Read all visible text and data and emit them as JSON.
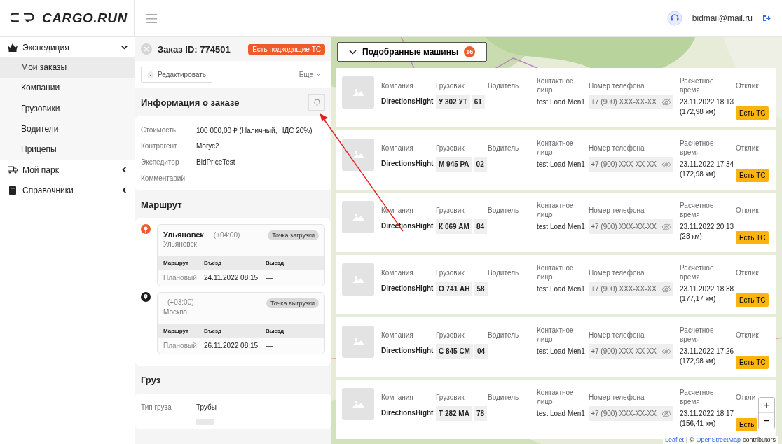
{
  "logo": {
    "text": "CARGO.RUN"
  },
  "user": {
    "email": "bidmail@mail.ru"
  },
  "sidebar": {
    "items": [
      {
        "label": "Экспедиция",
        "expanded": true,
        "children": [
          {
            "label": "Мои заказы",
            "selected": true
          },
          {
            "label": "Компании",
            "selected": false
          },
          {
            "label": "Грузовики",
            "selected": false
          },
          {
            "label": "Водители",
            "selected": false
          },
          {
            "label": "Прицепы",
            "selected": false
          }
        ]
      },
      {
        "label": "Мой парк",
        "expanded": false
      },
      {
        "label": "Справочники",
        "expanded": false
      }
    ]
  },
  "order": {
    "title": "Заказ ID: 774501",
    "status_badge": "Есть подходящие ТС",
    "edit_button": "Редактировать",
    "more_button": "Еще",
    "info": {
      "title": "Информация о заказе",
      "fields": [
        {
          "label": "Стоимость",
          "value": "100 000,00 ₽ (Наличный, НДС 20%)"
        },
        {
          "label": "Контрагент",
          "value": "Morус2"
        },
        {
          "label": "Экспедитор",
          "value": "BidPriceTest"
        },
        {
          "label": "Комментарий"
        }
      ]
    },
    "route": {
      "title": "Маршрут",
      "points": [
        {
          "kind": "loading",
          "city": "Ульяновск",
          "tz": "(+04:00)",
          "region": "Ульяновск",
          "tag": "Точка загрузки",
          "columns": [
            "Маршрут",
            "Въезд",
            "Выезд"
          ],
          "row": [
            "Плановый",
            "24.11.2022 08:15",
            "—"
          ]
        },
        {
          "kind": "unloading",
          "tz": "(+03:00)",
          "region": "Москва",
          "tag": "Точка выгрузки",
          "columns": [
            "Маршрут",
            "Въезд",
            "Выезд"
          ],
          "row": [
            "Плановый",
            "26.11.2022 08:15",
            "—"
          ]
        }
      ]
    },
    "cargo": {
      "title": "Груз",
      "fields": [
        {
          "label": "Тип груза",
          "value": "Трубы"
        }
      ]
    }
  },
  "matches": {
    "title": "Подобранные машины",
    "count": "16",
    "expanded": true,
    "cards": [
      {
        "company_label": "Компания",
        "truck_label": "Грузовик",
        "driver_label": "Водитель",
        "contact_label": "Контактное лицо",
        "phone_label": "Номер телефона",
        "time_label": "Расчетное время",
        "response_label": "Отклик",
        "company": "DirectionsHight",
        "plate": "У 302 УТ",
        "region": "61",
        "contact": "test Load Men1",
        "phone": "+7 (900) XXX-XX-XX",
        "time": "23.11.2022 18:13",
        "distance": "(172,98 км)",
        "response": "Есть ТС"
      },
      {
        "company_label": "Компания",
        "truck_label": "Грузовик",
        "driver_label": "Водитель",
        "contact_label": "Контактное лицо",
        "phone_label": "Номер телефона",
        "time_label": "Расчетное время",
        "response_label": "Отклик",
        "company": "DirectionsHight",
        "plate": "М 945 РА",
        "region": "02",
        "contact": "test Load Men1",
        "phone": "+7 (900) XXX-XX-XX",
        "time": "23.11.2022 17:34",
        "distance": "(172,98 км)",
        "response": "Есть ТС"
      },
      {
        "company_label": "Компания",
        "truck_label": "Грузовик",
        "driver_label": "Водитель",
        "contact_label": "Контактное лицо",
        "phone_label": "Номер телефона",
        "time_label": "Расчетное время",
        "response_label": "Отклик",
        "company": "DirectionsHight",
        "plate": "К 069 АМ",
        "region": "84",
        "contact": "test Load Men1",
        "phone": "+7 (900) XXX-XX-XX",
        "time": "23.11.2022 20:13",
        "distance": "(28 км)",
        "response": "Есть ТС"
      },
      {
        "company_label": "Компания",
        "truck_label": "Грузовик",
        "driver_label": "Водитель",
        "contact_label": "Контактное лицо",
        "phone_label": "Номер телефона",
        "time_label": "Расчетное время",
        "response_label": "Отклик",
        "company": "DirectionsHight",
        "plate": "О 741 АН",
        "region": "58",
        "contact": "test Load Men1",
        "phone": "+7 (900) XXX-XX-XX",
        "time": "23.11.2022 18:38",
        "distance": "(177,17 км)",
        "response": "Есть ТС"
      },
      {
        "company_label": "Компания",
        "truck_label": "Грузовик",
        "driver_label": "Водитель",
        "contact_label": "Контактное лицо",
        "phone_label": "Номер телефона",
        "time_label": "Расчетное время",
        "response_label": "Отклик",
        "company": "DirectionsHight",
        "plate": "С 845 СМ",
        "region": "04",
        "contact": "test Load Men1",
        "phone": "+7 (900) XXX-XX-XX",
        "time": "23.11.2022 17:26",
        "distance": "(172,98 км)",
        "response": "Есть ТС"
      },
      {
        "company_label": "Компания",
        "truck_label": "Грузовик",
        "driver_label": "Водитель",
        "contact_label": "Контактное лицо",
        "phone_label": "Номер телефона",
        "time_label": "Расчетное время",
        "response_label": "Откли",
        "company": "DirectionsHight",
        "plate": "Т 282 МА",
        "region": "78",
        "contact": "test Load Men1",
        "phone": "+7 (900) XXX-XX-XX",
        "time": "23.11.2022 18:17",
        "distance": "(156,41 км)",
        "response": "Есть"
      }
    ]
  },
  "map": {
    "zoom_in": "+",
    "zoom_out": "−",
    "attribution_link": "Leaflet",
    "attribution_sep": "| ©",
    "osm_link": "OpenStreetMap",
    "attribution_tail": "contributors"
  }
}
